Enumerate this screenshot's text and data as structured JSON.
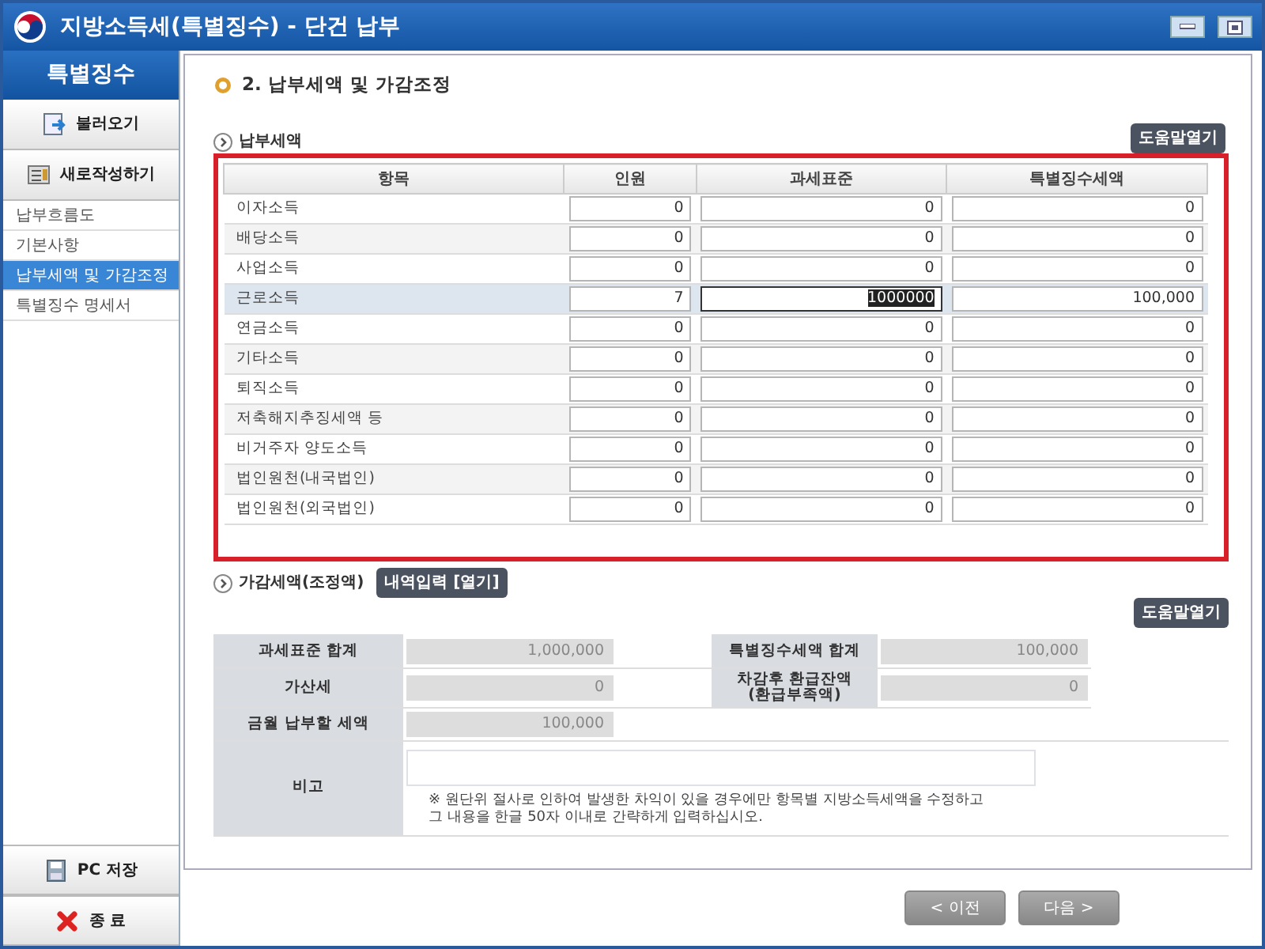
{
  "window": {
    "title": "지방소득세(특별징수) - 단건 납부"
  },
  "sidebar": {
    "header": "특별징수",
    "actions": [
      {
        "label": "불러오기",
        "kind": "load"
      },
      {
        "label": "새로작성하기",
        "kind": "new"
      }
    ],
    "items": [
      {
        "label": "납부흐름도",
        "selected": false
      },
      {
        "label": "기본사항",
        "selected": false
      },
      {
        "label": "납부세액 및 가감조정",
        "selected": true
      },
      {
        "label": "특별징수 명세서",
        "selected": false
      }
    ],
    "bottom_actions": [
      {
        "label": "PC 저장",
        "kind": "save"
      },
      {
        "label": "종 료",
        "kind": "exit"
      }
    ]
  },
  "section_title": "2. 납부세액 및 가감조정",
  "tax_section": {
    "title": "납부세액",
    "help_button": "도움말열기",
    "table": {
      "columns": [
        "항목",
        "인원",
        "과세표준",
        "특별징수세액"
      ],
      "rows": [
        {
          "item": "이자소득",
          "count": "0",
          "tax_base": "0",
          "tax": "0",
          "selected": false
        },
        {
          "item": "배당소득",
          "count": "0",
          "tax_base": "0",
          "tax": "0",
          "selected": false
        },
        {
          "item": "사업소득",
          "count": "0",
          "tax_base": "0",
          "tax": "0",
          "selected": false
        },
        {
          "item": "근로소득",
          "count": "7",
          "tax_base": "1000000",
          "tax": "100,000",
          "selected": true
        },
        {
          "item": "연금소득",
          "count": "0",
          "tax_base": "0",
          "tax": "0",
          "selected": false
        },
        {
          "item": "기타소득",
          "count": "0",
          "tax_base": "0",
          "tax": "0",
          "selected": false
        },
        {
          "item": "퇴직소득",
          "count": "0",
          "tax_base": "0",
          "tax": "0",
          "selected": false
        },
        {
          "item": "저축해지추징세액 등",
          "count": "0",
          "tax_base": "0",
          "tax": "0",
          "selected": false
        },
        {
          "item": "비거주자 양도소득",
          "count": "0",
          "tax_base": "0",
          "tax": "0",
          "selected": false
        },
        {
          "item": "법인원천(내국법인)",
          "count": "0",
          "tax_base": "0",
          "tax": "0",
          "selected": false
        },
        {
          "item": "법인원천(외국법인)",
          "count": "0",
          "tax_base": "0",
          "tax": "0",
          "selected": false
        }
      ]
    }
  },
  "adjust_section": {
    "title": "가감세액(조정액)",
    "entry_button": "내역입력 [열기]",
    "help_button": "도움말열기"
  },
  "summary": {
    "rows": [
      [
        {
          "label": "과세표준 합계",
          "value": "1,000,000"
        },
        {
          "label": "특별징수세액 합계",
          "value": "100,000"
        }
      ],
      [
        {
          "label": "가산세",
          "value": "0"
        },
        {
          "label": "차감후 환급잔액\n(환급부족액)",
          "value": "0"
        }
      ],
      [
        {
          "label": "금월 납부할 세액",
          "value": "100,000"
        }
      ]
    ],
    "remarks": {
      "label": "비고",
      "note": "※ 원단위 절사로 인하여 발생한 차익이 있을 경우에만 항목별 지방소득세액을 수정하고\n그 내용을 한글 50자 이내로 간략하게 입력하십시오."
    }
  },
  "nav_buttons": {
    "prev": "< 이전",
    "next": "다음 >"
  }
}
